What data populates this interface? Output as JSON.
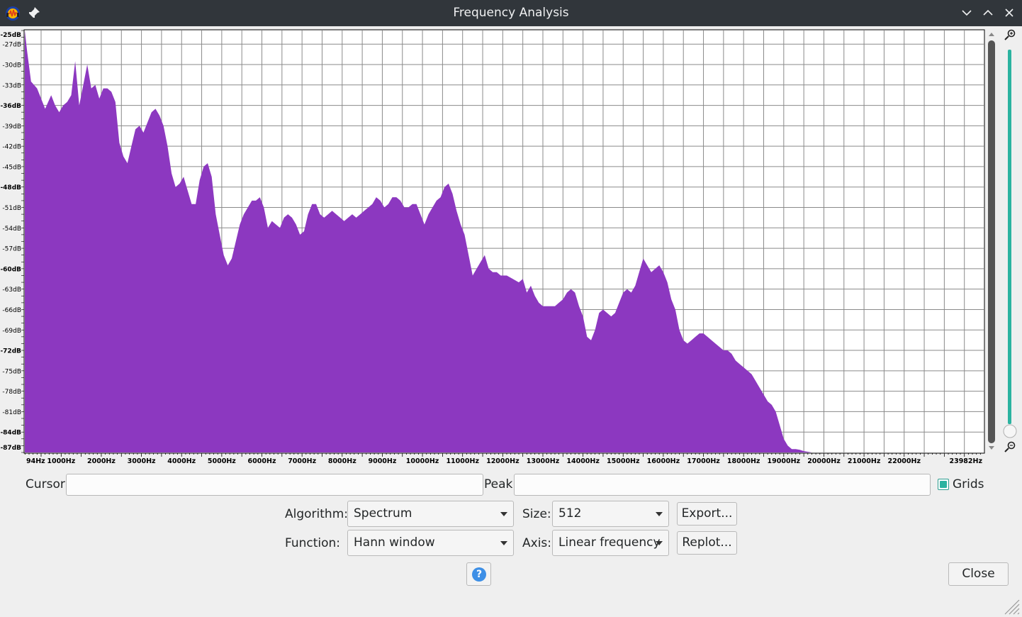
{
  "window": {
    "title": "Frequency Analysis",
    "icons": [
      "audacity-app-icon",
      "pin-icon",
      "minimize-icon",
      "maximize-icon",
      "close-icon"
    ]
  },
  "chart_data": {
    "type": "area",
    "title": "",
    "xlabel": "",
    "ylabel": "",
    "xlim": [
      94,
      23982
    ],
    "ylim": [
      -87,
      -25
    ],
    "grid": true,
    "fill_color": "#8c38c0",
    "x_tick_labels": [
      "94Hz",
      "1000Hz",
      "2000Hz",
      "3000Hz",
      "4000Hz",
      "5000Hz",
      "6000Hz",
      "7000Hz",
      "8000Hz",
      "9000Hz",
      "10000Hz",
      "11000Hz",
      "12000Hz",
      "13000Hz",
      "14000Hz",
      "15000Hz",
      "16000Hz",
      "17000Hz",
      "18000Hz",
      "19000Hz",
      "20000Hz",
      "21000Hz",
      "22000Hz",
      "23982Hz"
    ],
    "x_tick_values": [
      94,
      1000,
      2000,
      3000,
      4000,
      5000,
      6000,
      7000,
      8000,
      9000,
      10000,
      11000,
      12000,
      13000,
      14000,
      15000,
      16000,
      17000,
      18000,
      19000,
      20000,
      21000,
      22000,
      23982
    ],
    "y_tick_labels": [
      "-25dB",
      "-27dB",
      "-30dB",
      "-33dB",
      "-36dB",
      "-39dB",
      "-42dB",
      "-45dB",
      "-48dB",
      "-51dB",
      "-54dB",
      "-57dB",
      "-60dB",
      "-63dB",
      "-66dB",
      "-69dB",
      "-72dB",
      "-75dB",
      "-78dB",
      "-81dB",
      "-84dB",
      "-87dB"
    ],
    "y_tick_values": [
      -25,
      -27,
      -30,
      -33,
      -36,
      -39,
      -42,
      -45,
      -48,
      -51,
      -54,
      -57,
      -60,
      -63,
      -66,
      -69,
      -72,
      -75,
      -78,
      -81,
      -84,
      -87
    ],
    "y_bold_values": [
      -25,
      -36,
      -48,
      -60,
      -72,
      -84,
      -87
    ],
    "x": [
      94,
      150,
      250,
      400,
      500,
      600,
      750,
      850,
      950,
      1050,
      1150,
      1250,
      1350,
      1450,
      1550,
      1650,
      1750,
      1850,
      1950,
      2050,
      2150,
      2250,
      2350,
      2450,
      2550,
      2650,
      2750,
      2850,
      2950,
      3050,
      3150,
      3250,
      3350,
      3450,
      3550,
      3650,
      3750,
      3850,
      3950,
      4050,
      4150,
      4250,
      4350,
      4450,
      4550,
      4650,
      4750,
      4850,
      4950,
      5050,
      5150,
      5250,
      5350,
      5450,
      5550,
      5650,
      5750,
      5850,
      5950,
      6050,
      6150,
      6250,
      6350,
      6450,
      6550,
      6650,
      6750,
      6850,
      6950,
      7050,
      7150,
      7250,
      7350,
      7450,
      7550,
      7650,
      7750,
      7850,
      7950,
      8050,
      8150,
      8250,
      8350,
      8450,
      8550,
      8650,
      8750,
      8850,
      8950,
      9050,
      9150,
      9250,
      9350,
      9450,
      9550,
      9650,
      9750,
      9850,
      9950,
      10050,
      10150,
      10250,
      10350,
      10450,
      10550,
      10650,
      10750,
      10850,
      10950,
      11050,
      11150,
      11250,
      11350,
      11450,
      11550,
      11650,
      11750,
      11850,
      11950,
      12100,
      12250,
      12400,
      12500,
      12600,
      12700,
      12800,
      12900,
      13000,
      13100,
      13200,
      13300,
      13400,
      13500,
      13600,
      13700,
      13800,
      13900,
      14000,
      14100,
      14200,
      14300,
      14400,
      14500,
      14600,
      14700,
      14800,
      14900,
      15000,
      15100,
      15200,
      15300,
      15400,
      15500,
      15600,
      15700,
      15800,
      15900,
      16000,
      16100,
      16200,
      16300,
      16400,
      16500,
      16600,
      16700,
      16800,
      16900,
      17000,
      17100,
      17200,
      17300,
      17400,
      17500,
      17600,
      17700,
      17800,
      17900,
      18000,
      18100,
      18200,
      18300,
      18400,
      18500,
      18600,
      18700,
      18800,
      18900,
      19000,
      19100,
      19200,
      19300,
      19400,
      19500,
      19600,
      19700,
      19800,
      19900,
      20000,
      20200,
      20500,
      20800,
      21000,
      21300,
      21600,
      22000,
      22400,
      22800,
      23200,
      23600,
      23982
    ],
    "values": [
      -25,
      -28,
      -32.5,
      -33.5,
      -35,
      -36.5,
      -34.5,
      -36,
      -37,
      -36,
      -35.5,
      -34.5,
      -29.5,
      -36,
      -33,
      -30,
      -33.5,
      -33,
      -35,
      -33.5,
      -33.5,
      -34,
      -35.5,
      -41.5,
      -43.5,
      -44.5,
      -42,
      -39.5,
      -39,
      -40,
      -38.5,
      -37,
      -36.5,
      -37.5,
      -39,
      -42,
      -46,
      -48,
      -47.5,
      -46.5,
      -48.5,
      -50.5,
      -50.5,
      -47,
      -45,
      -44.5,
      -46.5,
      -52,
      -55,
      -58,
      -59.5,
      -58.5,
      -56,
      -53.5,
      -52,
      -51,
      -50,
      -50,
      -49.5,
      -51,
      -54,
      -53,
      -53.5,
      -54,
      -52.5,
      -52,
      -52.5,
      -53.5,
      -55,
      -54.5,
      -52,
      -50.5,
      -50.5,
      -52,
      -52.5,
      -52,
      -51.5,
      -52,
      -52.5,
      -53,
      -52.5,
      -52,
      -52.5,
      -52,
      -51.5,
      -51,
      -50.5,
      -49.5,
      -50,
      -51,
      -50.5,
      -49.5,
      -49.5,
      -50,
      -51,
      -51,
      -50.5,
      -50.5,
      -52,
      -53.5,
      -52,
      -51,
      -50,
      -49.5,
      -48,
      -47.5,
      -49,
      -51.5,
      -53.5,
      -55,
      -58,
      -61,
      -60,
      -59,
      -58,
      -60,
      -60.5,
      -60.5,
      -61,
      -61,
      -61.5,
      -62,
      -61.5,
      -63.5,
      -62.5,
      -64,
      -65,
      -65.5,
      -65.5,
      -65.5,
      -65.5,
      -65,
      -64.5,
      -63.5,
      -63,
      -63.5,
      -65.5,
      -67,
      -70,
      -70.5,
      -69,
      -66.5,
      -66,
      -66.5,
      -67,
      -66.5,
      -65,
      -63.5,
      -63,
      -63.5,
      -62.5,
      -60.5,
      -58.5,
      -59.5,
      -60.5,
      -60,
      -59.5,
      -60.5,
      -62,
      -64.5,
      -66,
      -69,
      -70.5,
      -71,
      -70.5,
      -70,
      -69.5,
      -69.5,
      -70,
      -70.5,
      -71,
      -71.5,
      -72,
      -72,
      -72.5,
      -73.5,
      -74,
      -74.5,
      -75,
      -75.5,
      -76.5,
      -77.5,
      -78.5,
      -79.5,
      -80,
      -81,
      -83,
      -85,
      -86,
      -86.5,
      -86.5,
      -86.6,
      -86.8,
      -86.9,
      -87,
      -87,
      -87,
      -87.2,
      -87.5,
      -88,
      -88.5,
      -89,
      -90.5
    ]
  },
  "controls": {
    "cursor_label": "Cursor:",
    "cursor_value": "",
    "peak_label": "Peak:",
    "peak_value": "",
    "grids_label": "Grids",
    "grids_checked": true,
    "algorithm_label": "Algorithm:",
    "algorithm_value": "Spectrum",
    "size_label": "Size:",
    "size_value": "512",
    "export_label": "Export...",
    "function_label": "Function:",
    "function_value": "Hann window",
    "axis_label": "Axis:",
    "axis_value": "Linear frequency",
    "replot_label": "Replot...",
    "help_label": "?",
    "close_label": "Close"
  },
  "colors": {
    "titlebar": "#31363b",
    "spectrum_fill": "#8c38c0",
    "zoom_slider": "#2bb3a0",
    "grids_checkbox": "#2bb3a0",
    "help_icon": "#3d8fe6"
  }
}
